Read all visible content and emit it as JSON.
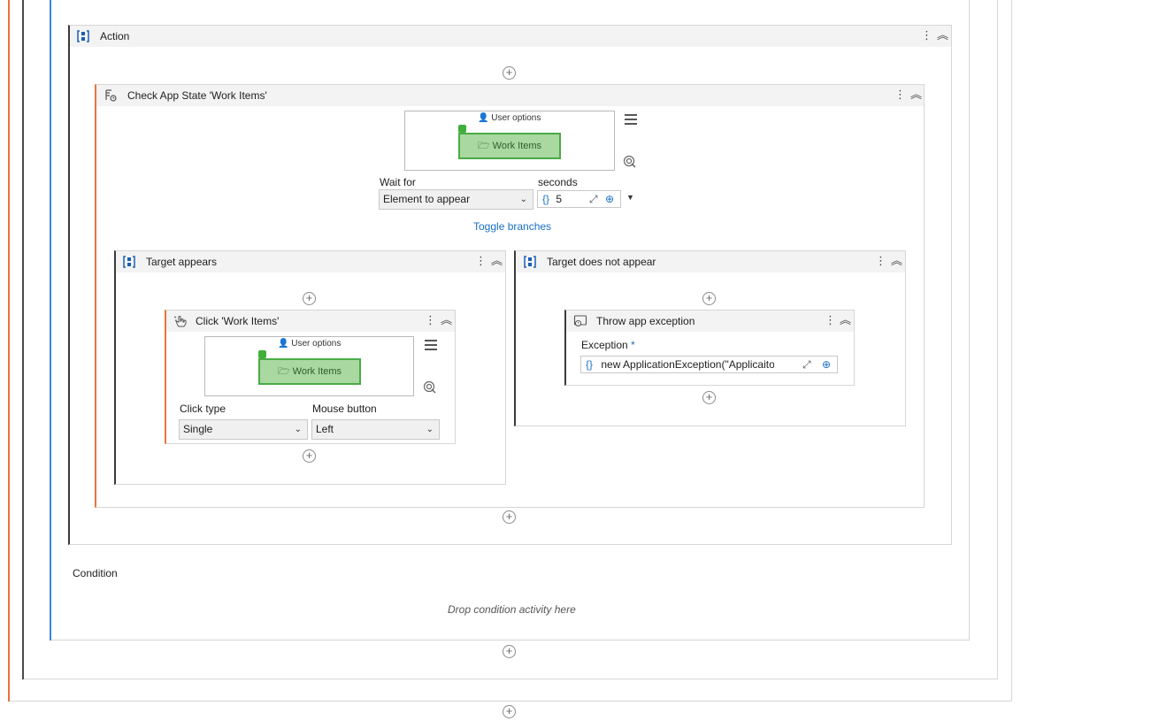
{
  "action": {
    "title": "Action"
  },
  "check_app_state": {
    "title": "Check App State 'Work Items'",
    "target": {
      "window_label": "User options",
      "element_label": "Work Items"
    },
    "wait_for": {
      "label": "Wait for",
      "value": "Element to appear"
    },
    "seconds": {
      "label": "seconds",
      "value": "5"
    },
    "toggle_branches": "Toggle branches"
  },
  "target_appears": {
    "title": "Target appears",
    "click_activity": {
      "title": "Click 'Work Items'",
      "target": {
        "window_label": "User options",
        "element_label": "Work Items"
      },
      "click_type": {
        "label": "Click type",
        "value": "Single"
      },
      "mouse_button": {
        "label": "Mouse button",
        "value": "Left"
      }
    }
  },
  "target_not_appear": {
    "title": "Target does not appear",
    "throw_activity": {
      "title": "Throw app exception",
      "exception": {
        "label": "Exception",
        "required_mark": "*",
        "value": "new ApplicationException(\"Applicaiton n"
      }
    }
  },
  "condition": {
    "label": "Condition",
    "drop_hint": "Drop condition activity here"
  },
  "colors": {
    "orange": "#e8743b",
    "blue": "#3b87d6",
    "dark": "#3a3a3a",
    "green": "#4aab46"
  },
  "icons": {
    "sequence": "sequence-icon",
    "check_state": "check-app-state-icon",
    "click": "click-icon",
    "throw": "throw-icon",
    "menu": "more-vertical-icon",
    "collapse": "collapse-icon"
  }
}
